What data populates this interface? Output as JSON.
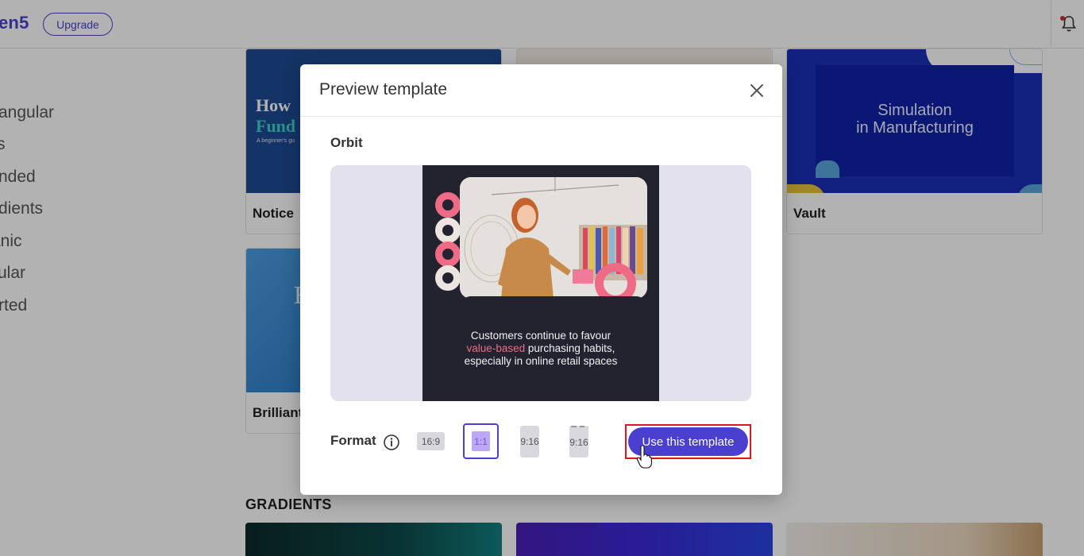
{
  "header": {
    "brand": "en5",
    "upgrade_label": "Upgrade"
  },
  "sidebar": {
    "items": [
      "angular",
      "s",
      "nded",
      "dients",
      "anic",
      "ular",
      "rted"
    ]
  },
  "cards": {
    "notice": {
      "label": "Notice",
      "thumb_title_line1": "How",
      "thumb_title_line2": "Fund",
      "thumb_subtitle": "A beginner's gu"
    },
    "vault": {
      "label": "Vault",
      "thumb_line1": "Simulation",
      "thumb_line2": "in Manufacturing"
    },
    "brilliant": {
      "label": "Brilliant",
      "thumb_letter": "E"
    }
  },
  "sections": {
    "gradients": "GRADIENTS"
  },
  "modal": {
    "title": "Preview template",
    "template_name": "Orbit",
    "slide_caption": {
      "line1": "Customers continue to favour",
      "line2_highlight": "value-based",
      "line2_rest": " purchasing habits,",
      "line3": "especially in online retail spaces"
    },
    "format_label": "Format",
    "formats": [
      "16:9",
      "1:1",
      "9:16",
      "9:16"
    ],
    "selected_format": "1:1",
    "use_button": "Use this template"
  },
  "colors": {
    "brand": "#4b3fd0",
    "highlight": "#ef6a85",
    "annotation": "#e0161e"
  },
  "icons": [
    "bell-icon",
    "close-icon",
    "info-icon",
    "pointer-cursor-icon"
  ]
}
